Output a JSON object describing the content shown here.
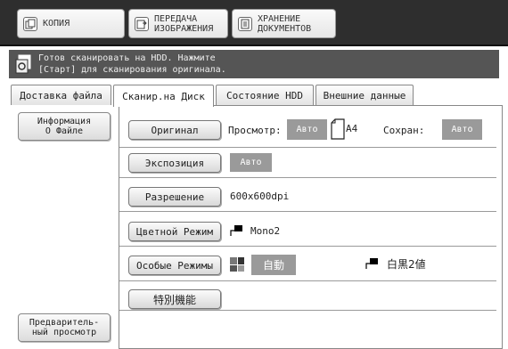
{
  "mode_tabs": [
    {
      "label": "КОПИЯ",
      "icon": "copy-icon"
    },
    {
      "label": "ПЕРЕДАЧА\nИЗОБРАЖЕНИЯ",
      "icon": "image-send-icon"
    },
    {
      "label": "ХРАНЕНИЕ\nДОКУМЕНТОВ",
      "icon": "document-filing-icon"
    }
  ],
  "message": {
    "icon": "scan-document-icon",
    "line1": "Готов сканировать на HDD. Нажмите",
    "line2": "[Старт] для сканирования оригинала."
  },
  "tabs": [
    {
      "label": "Доставка файла"
    },
    {
      "label": "Сканир.на Диск",
      "active": true
    },
    {
      "label": "Состояние HDD"
    },
    {
      "label": "Внешние данные"
    }
  ],
  "side": {
    "file_info": "Информация\nО Файле",
    "preview": "Предваритель-\nный просмотр"
  },
  "settings": {
    "original": {
      "button": "Оригинал",
      "view_label": "Просмотр:",
      "view_value": "Авто",
      "paper": "A4",
      "save_label": "Сохран:",
      "save_value": "Авто"
    },
    "exposure": {
      "button": "Экспозиция",
      "value": "Авто"
    },
    "resolution": {
      "button": "Разрешение",
      "value": "600x600dpi"
    },
    "color_mode": {
      "button": "Цветной Режим",
      "value": "Mono2"
    },
    "special_modes": {
      "button": "Особые Режимы",
      "value": "自動",
      "value2": "白黒2値"
    },
    "special_functions": {
      "button": "特別機能"
    }
  },
  "colors": {
    "topbar": "#2e2e2e",
    "message_bar": "#555555",
    "value_box": "#9a9a9a"
  }
}
